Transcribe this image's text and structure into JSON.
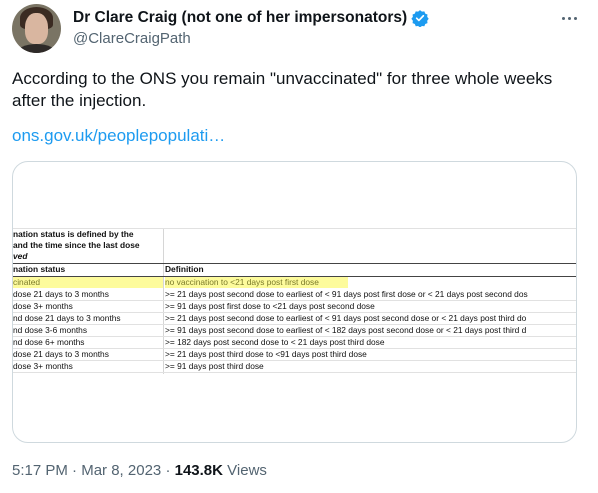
{
  "author": {
    "display_name": "Dr Clare Craig (not one of her impersonators)",
    "handle": "@ClareCraigPath",
    "verified_color": "#1d9bf0"
  },
  "tweet": {
    "text": "According to the ONS you remain \"unvaccinated\" for three whole weeks after the injection.",
    "link_text": "ons.gov.uk/peoplepopulati…",
    "time": "5:17 PM",
    "date": "Mar 8, 2023",
    "views_count": "143.8K",
    "views_label": "Views",
    "separator": "·"
  },
  "table": {
    "intro_lines": [
      "nation status is defined by the",
      "and the time since the last dose",
      "ved"
    ],
    "headers": {
      "status": "nation status",
      "definition": "Definition"
    },
    "rows": [
      {
        "status": "cinated",
        "definition": "no vaccination to <21 days post first dose",
        "highlight": true
      },
      {
        "status": "dose 21 days to 3 months",
        "definition": ">= 21 days post second dose to earliest of < 91 days post first dose or < 21 days post second dos"
      },
      {
        "status": "dose 3+ months",
        "definition": ">= 91 days post first dose to <21 days post second dose"
      },
      {
        "status": "nd dose 21 days to 3 months",
        "definition": ">= 21 days post second dose to earliest of < 91 days post second dose or < 21 days post third do"
      },
      {
        "status": "nd dose 3-6 months",
        "definition": ">= 91 days post second dose to earliest of < 182 days post second dose or < 21 days post third d"
      },
      {
        "status": "nd dose 6+ months",
        "definition": ">= 182 days post second dose to < 21 days post third dose"
      },
      {
        "status": "dose 21 days to 3 months",
        "definition": ">= 21 days post third dose to <91 days post third dose"
      },
      {
        "status": "dose 3+ months",
        "definition": ">= 91 days post third dose"
      }
    ]
  },
  "colors": {
    "link": "#1d9bf0",
    "secondary_text": "#536471",
    "highlight": "#fdfb9c"
  }
}
